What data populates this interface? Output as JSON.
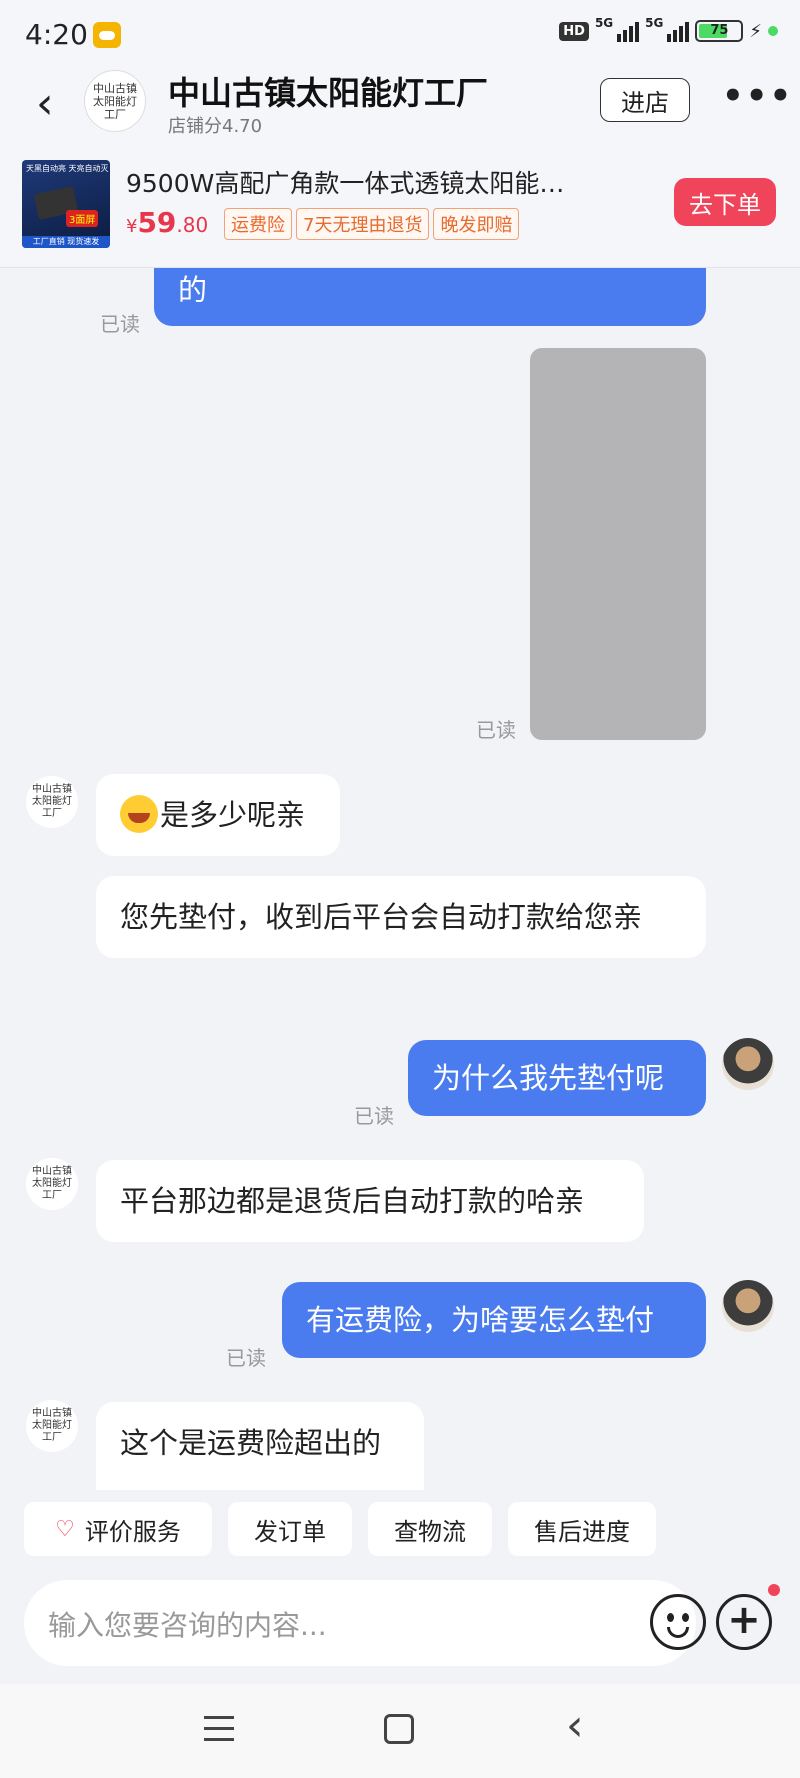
{
  "status": {
    "time": "4:20",
    "hd": "HD",
    "net1": "5G",
    "net2": "5G",
    "battery": "75"
  },
  "header": {
    "shop_name": "中山古镇太阳能灯工厂",
    "shop_score": "店铺分4.70",
    "avatar_text": "中山古镇太阳能灯工厂",
    "enter_label": "进店",
    "more_label": "•••"
  },
  "product": {
    "title": "9500W高配广角款一体式透镜太阳能…",
    "price_currency": "¥",
    "price_int": "59",
    "price_dec": ".80",
    "tags": [
      "运费险",
      "7天无理由退货",
      "晚发即赔"
    ],
    "order_label": "去下单",
    "thumb_text_top": "天黑自动亮 天亮自动灭",
    "thumb_badge": "3面屏",
    "thumb_text_bottom": "工厂直销 现货速发"
  },
  "messages": [
    {
      "side": "out",
      "text": "的",
      "read": "已读"
    },
    {
      "side": "out",
      "type": "image",
      "read": "已读"
    },
    {
      "side": "in",
      "text": "是多少呢亲",
      "emoji": "laughing-tears"
    },
    {
      "side": "in",
      "text": "您先垫付，收到后平台会自动打款给您亲"
    },
    {
      "side": "out",
      "text": "为什么我先垫付呢",
      "read": "已读"
    },
    {
      "side": "in",
      "text": "平台那边都是退货后自动打款的哈亲"
    },
    {
      "side": "out",
      "text": "有运费险，为啥要怎么垫付",
      "read": "已读"
    },
    {
      "side": "in",
      "text": "这个是运费险超出的"
    }
  ],
  "quick_actions": [
    "评价服务",
    "发订单",
    "查物流",
    "售后进度"
  ],
  "input": {
    "placeholder": "输入您要咨询的内容..."
  },
  "colors": {
    "accent": "#4a7cf0",
    "order_button": "#f0445a",
    "price": "#e8364a"
  }
}
